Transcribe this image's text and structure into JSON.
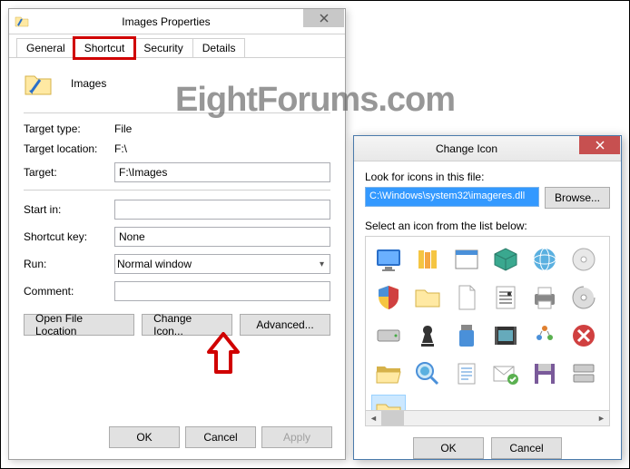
{
  "watermark": "EightForums.com",
  "properties": {
    "title": "Images Properties",
    "tabs": [
      "General",
      "Shortcut",
      "Security",
      "Details"
    ],
    "active_tab": 1,
    "icon_label": "Images",
    "rows": {
      "target_type": {
        "label": "Target type:",
        "value": "File"
      },
      "target_location": {
        "label": "Target location:",
        "value": "F:\\"
      },
      "target": {
        "label": "Target:",
        "value": "F:\\Images"
      },
      "start_in": {
        "label": "Start in:",
        "value": ""
      },
      "shortcut_key": {
        "label": "Shortcut key:",
        "value": "None"
      },
      "run": {
        "label": "Run:",
        "value": "Normal window"
      },
      "comment": {
        "label": "Comment:",
        "value": ""
      }
    },
    "buttons": {
      "open_file_location": "Open File Location",
      "change_icon": "Change Icon...",
      "advanced": "Advanced..."
    },
    "bottom": {
      "ok": "OK",
      "cancel": "Cancel",
      "apply": "Apply"
    }
  },
  "change_icon": {
    "title": "Change Icon",
    "look_label": "Look for icons in this file:",
    "path": "C:\\Windows\\system32\\imageres.dll",
    "browse": "Browse...",
    "select_label": "Select an icon from the list below:",
    "ok": "OK",
    "cancel": "Cancel",
    "selected_index": 24,
    "icons": [
      "monitor-blue",
      "library-yellow",
      "app-window",
      "box-teal",
      "globe-network",
      "disc",
      "shield",
      "folder-yellow",
      "page",
      "sheet-music",
      "printer",
      "disc-silver",
      "drive",
      "chess-piece",
      "usb-drive",
      "film-frame",
      "users-pyramid",
      "delete-x",
      "folder-open",
      "magnifier-globe",
      "notepad",
      "mail-envelope-check",
      "floppy-purple",
      "storage",
      "folder-selected",
      "",
      "",
      "",
      "",
      ""
    ]
  }
}
